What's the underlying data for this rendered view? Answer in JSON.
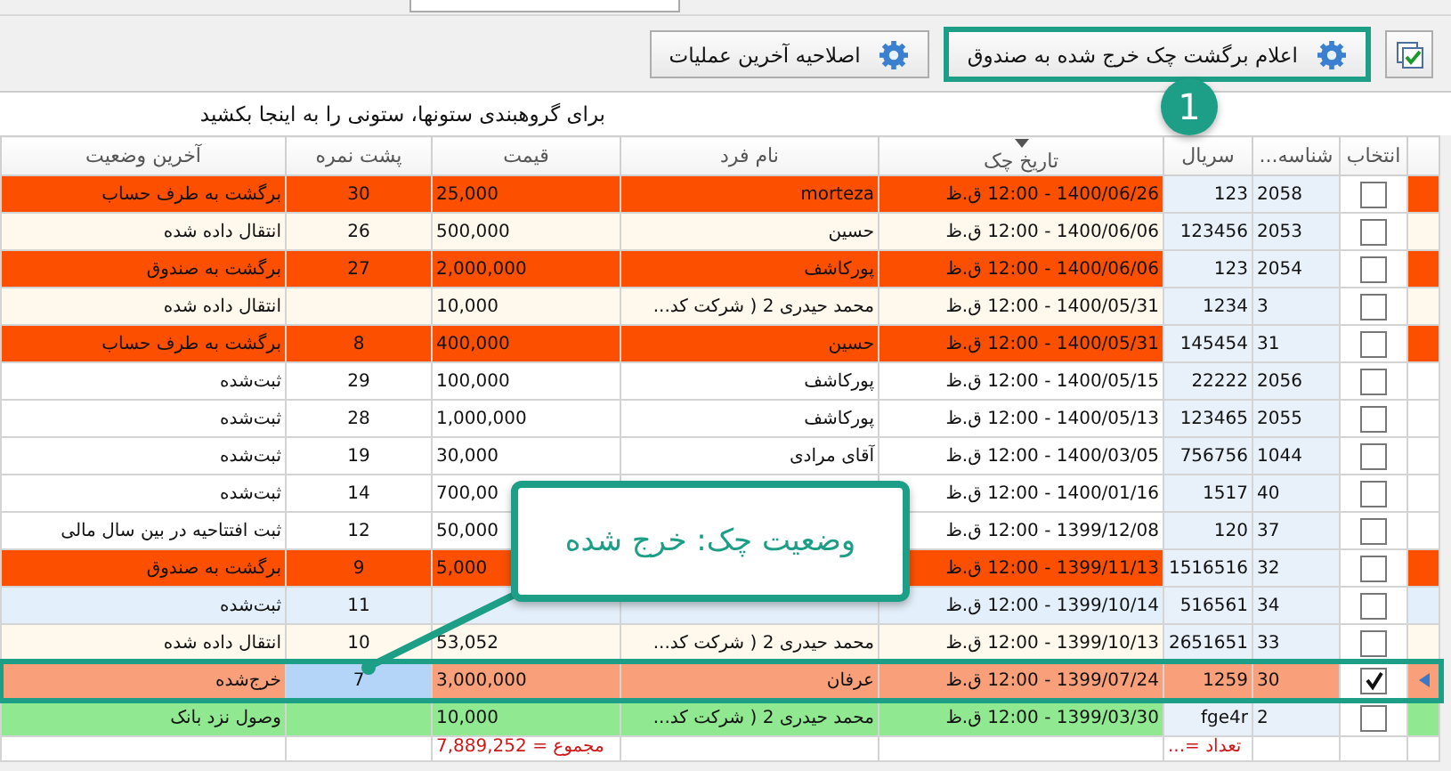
{
  "top_field": {
    "kind": "field"
  },
  "toolbar": {
    "buttons": [
      {
        "kind": "select-all",
        "highlighted": false
      },
      {
        "kind": "action",
        "label": "اعلام برگشت چک خرج شده به صندوق",
        "highlighted": true
      },
      {
        "kind": "action",
        "label": "اصلاحیه آخرین عملیات",
        "highlighted": false
      }
    ]
  },
  "group_hint": "برای گروهبندی ستونها، ستونی را به اینجا بکشید",
  "table": {
    "columns": [
      {
        "label": "انتخاب",
        "sorted": false
      },
      {
        "label": "شناسه...",
        "sorted": false
      },
      {
        "label": "سریال",
        "sorted": false
      },
      {
        "label": "تاریخ چک",
        "sorted": true
      },
      {
        "label": "نام فرد",
        "sorted": false
      },
      {
        "label": "قیمت",
        "sorted": false
      },
      {
        "label": "پشت نمره",
        "sorted": false
      },
      {
        "label": "آخرین وضعیت",
        "sorted": false
      }
    ],
    "rows": [
      {
        "id": "2058",
        "serial": "123",
        "date": "1400/06/26 - 12:00 ق.ظ",
        "name": "morteza",
        "price": "25,000",
        "back_number": "30",
        "status": "برگشت به طرف حساب",
        "color": "#fc5000",
        "checked": false,
        "selected": false
      },
      {
        "id": "2053",
        "serial": "123456",
        "date": "1400/06/06 - 12:00 ق.ظ",
        "name": "حسین",
        "price": "500,000",
        "back_number": "26",
        "status": "انتقال داده شده",
        "color": "#fff8ec",
        "checked": false,
        "selected": false
      },
      {
        "id": "2054",
        "serial": "123",
        "date": "1400/06/06 - 12:00 ق.ظ",
        "name": "پورکاشف",
        "price": "2,000,000",
        "back_number": "27",
        "status": "برگشت به صندوق",
        "color": "#fc5000",
        "checked": false,
        "selected": false
      },
      {
        "id": "3",
        "serial": "1234",
        "date": "1400/05/31 - 12:00 ق.ظ",
        "name": "محمد حیدری 2 ( شرکت کد...",
        "price": "10,000",
        "status": "انتقال داده شده",
        "color": "#fff8ec",
        "checked": false,
        "selected": false
      },
      {
        "id": "31",
        "serial": "145454",
        "date": "1400/05/31 - 12:00 ق.ظ",
        "name": "حسین",
        "price": "400,000",
        "back_number": "8",
        "status": "برگشت به طرف حساب",
        "color": "#fc5000",
        "checked": false,
        "selected": false
      },
      {
        "id": "2056",
        "serial": "22222",
        "date": "1400/05/15 - 12:00 ق.ظ",
        "name": "پورکاشف",
        "price": "100,000",
        "back_number": "29",
        "status": "ثبت‌شده",
        "color": "#ffffff",
        "checked": false,
        "selected": false
      },
      {
        "id": "2055",
        "serial": "123465",
        "date": "1400/05/13 - 12:00 ق.ظ",
        "name": "پورکاشف",
        "price": "1,000,000",
        "back_number": "28",
        "status": "ثبت‌شده",
        "color": "#ffffff",
        "checked": false,
        "selected": false
      },
      {
        "id": "1044",
        "serial": "756756",
        "date": "1400/03/05 - 12:00 ق.ظ",
        "name": "آقای مرادی",
        "price": "30,000",
        "back_number": "19",
        "status": "ثبت‌شده",
        "color": "#ffffff",
        "checked": false,
        "selected": false
      },
      {
        "id": "40",
        "serial": "1517",
        "date": "1400/01/16 - 12:00 ق.ظ",
        "price": "700,00",
        "back_number": "14",
        "status": "ثبت‌شده",
        "color": "#ffffff",
        "checked": false,
        "selected": false
      },
      {
        "id": "37",
        "serial": "120",
        "date": "1399/12/08 - 12:00 ق.ظ",
        "price": "50,000",
        "back_number": "12",
        "status": "ثبت افتتاحیه در بین سال مالی",
        "color": "#ffffff",
        "checked": false,
        "selected": false
      },
      {
        "id": "32",
        "serial": "1516516",
        "date": "1399/11/13 - 12:00 ق.ظ",
        "price": "5,000",
        "back_number": "9",
        "status": "برگشت به صندوق",
        "color": "#fc5000",
        "checked": false,
        "selected": false
      },
      {
        "id": "34",
        "serial": "516561",
        "date": "1399/10/14 - 12:00 ق.ظ",
        "back_number": "11",
        "status": "ثبت‌شده",
        "color": "#e3effa",
        "checked": false,
        "selected": false
      },
      {
        "id": "33",
        "serial": "2651651",
        "date": "1399/10/13 - 12:00 ق.ظ",
        "name": "محمد حیدری 2 ( شرکت کد...",
        "price": "53,052",
        "back_number": "10",
        "status": "انتقال داده شده",
        "color": "#fff8ec",
        "checked": false,
        "selected": false
      },
      {
        "id": "30",
        "serial": "1259",
        "date": "1399/07/24 - 12:00 ق.ظ",
        "name": "عرفان",
        "price": "3,000,000",
        "back_number": "7",
        "status": "خرج‌شده",
        "color": "#f9a07a",
        "checked": true,
        "selected": true
      },
      {
        "id": "2",
        "serial": "fge4r",
        "date": "1399/03/30 - 12:00 ق.ظ",
        "name": "محمد حیدری 2 ( شرکت کد...",
        "price": "10,000",
        "status": "وصول نزد بانک",
        "color": "#90e890",
        "checked": false,
        "selected": false
      }
    ],
    "footer": {
      "count": "تعداد =...",
      "sum": "مجموع = 7,889,252"
    }
  },
  "callout": {
    "text": "وضعیت چک: خرج شده"
  },
  "step_badge": {
    "text": "1"
  }
}
